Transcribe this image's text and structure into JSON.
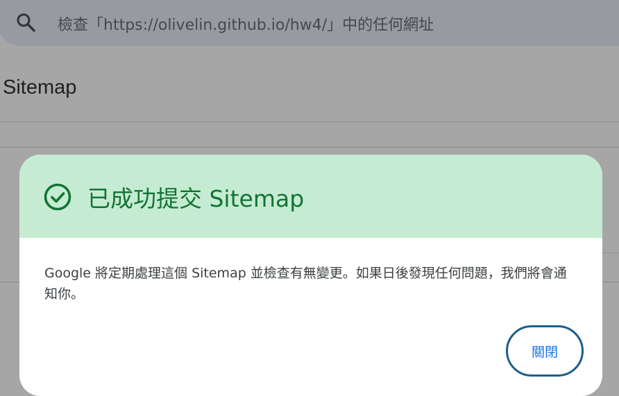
{
  "search": {
    "placeholder": "檢查「https://olivelin.github.io/hw4/」中的任何網址",
    "icon": "search-icon"
  },
  "page": {
    "title": "Sitemap"
  },
  "dialog": {
    "title": "已成功提交 Sitemap",
    "icon": "check-circle-icon",
    "body": "Google 將定期處理這個 Sitemap 並檢查有無變更。如果日後發現任何問題，我們將會通知你。",
    "close_label": "關閉"
  },
  "colors": {
    "header_bg": "#c5ecd3",
    "success_green": "#137333",
    "button_border": "#1a5e8a",
    "button_text": "#1a73e8",
    "search_bg": "#e6ebf4"
  }
}
